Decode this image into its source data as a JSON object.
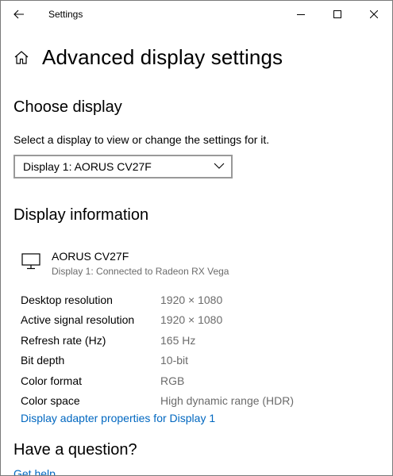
{
  "titlebar": {
    "title": "Settings",
    "icons": {
      "back": "back-arrow-icon",
      "minimize": "minimize-icon",
      "maximize": "maximize-icon",
      "close": "close-icon"
    }
  },
  "header": {
    "title": "Advanced display settings",
    "icon": "home-icon"
  },
  "choose_display": {
    "title": "Choose display",
    "description": "Select a display to view or change the settings for it.",
    "selected": "Display 1: AORUS CV27F"
  },
  "display_info": {
    "title": "Display information",
    "monitor_name": "AORUS CV27F",
    "monitor_sub": "Display 1: Connected to Radeon RX Vega",
    "rows": [
      {
        "label": "Desktop resolution",
        "value": "1920 × 1080"
      },
      {
        "label": "Active signal resolution",
        "value": "1920 × 1080"
      },
      {
        "label": "Refresh rate (Hz)",
        "value": "165 Hz"
      },
      {
        "label": "Bit depth",
        "value": "10-bit"
      },
      {
        "label": "Color format",
        "value": "RGB"
      },
      {
        "label": "Color space",
        "value": "High dynamic range (HDR)"
      }
    ],
    "adapter_link": "Display adapter properties for Display 1"
  },
  "question": {
    "title": "Have a question?",
    "help_link": "Get help"
  },
  "colors": {
    "link": "#0067c0",
    "secondary_text": "#6b6b6b",
    "dropdown_border": "#999999"
  }
}
